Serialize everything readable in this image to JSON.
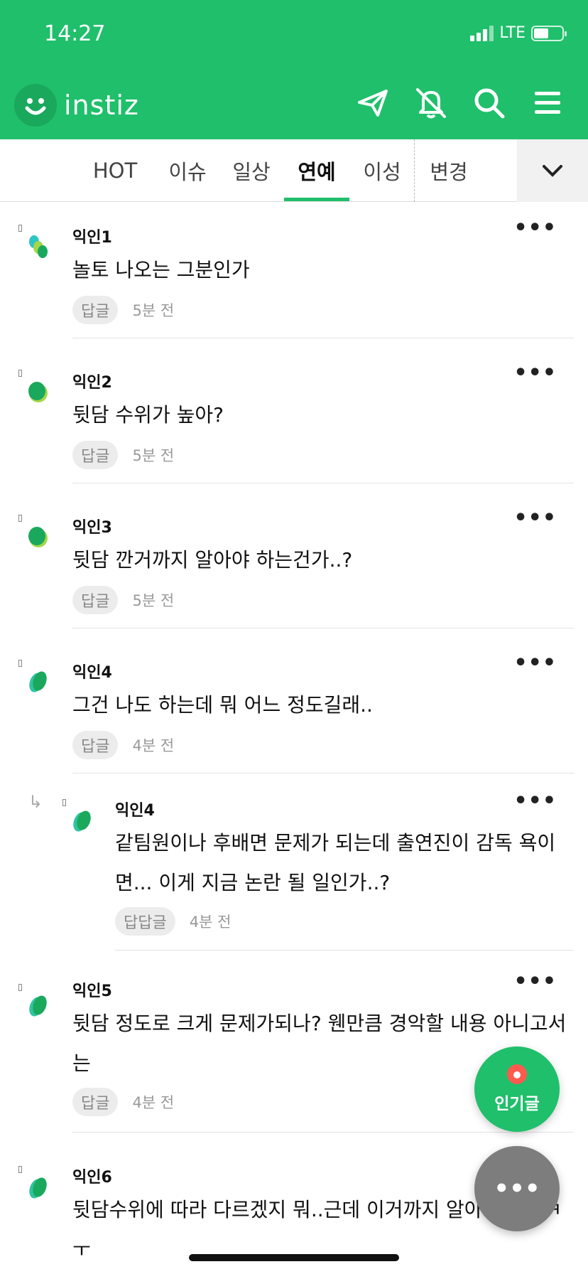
{
  "status_bar": {
    "time": "14:27",
    "network": "LTE"
  },
  "header": {
    "logo_text": "instiz"
  },
  "tabs": [
    {
      "label": "HOT"
    },
    {
      "label": "이슈"
    },
    {
      "label": "일상"
    },
    {
      "label": "연예"
    },
    {
      "label": "이성"
    },
    {
      "label": "변경"
    }
  ],
  "comments": [
    {
      "name": "익인1",
      "text": "놀토 나오는 그분인가",
      "reply_label": "답글",
      "time": "5분 전"
    },
    {
      "name": "익인2",
      "text": "뒷담 수위가 높아?",
      "reply_label": "답글",
      "time": "5분 전"
    },
    {
      "name": "익인3",
      "text": "뒷담 깐거까지 알아야 하는건가..?",
      "reply_label": "답글",
      "time": "5분 전"
    },
    {
      "name": "익인4",
      "text": "그건 나도 하는데 뭐 어느 정도길래..",
      "reply_label": "답글",
      "time": "4분 전"
    },
    {
      "name": "익인4",
      "text_line1": "같팀원이나 후배면 문제가 되는데 출연진이 감독 욕이",
      "text_line2": "면... 이게 지금 논란 될 일인가..?",
      "reply_label": "답답글",
      "time": "4분 전"
    },
    {
      "name": "익인5",
      "text_line1": "뒷담 정도로 크게 문제가되나? 웬만큼 경악할 내용 아니고서",
      "text_line2": "는",
      "reply_label": "답글",
      "time": "4분 전"
    },
    {
      "name": "익인6",
      "text_line1": "뒷담수위에 따라 다르겠지 뭐..근데 이거까지 알아야하나 ㅋ",
      "text_line2": "ㅜ"
    }
  ],
  "fab": {
    "hot_label": "인기글"
  },
  "colors": {
    "brand_green": "#20bf6b",
    "fab_gray": "#7d7d7d"
  }
}
